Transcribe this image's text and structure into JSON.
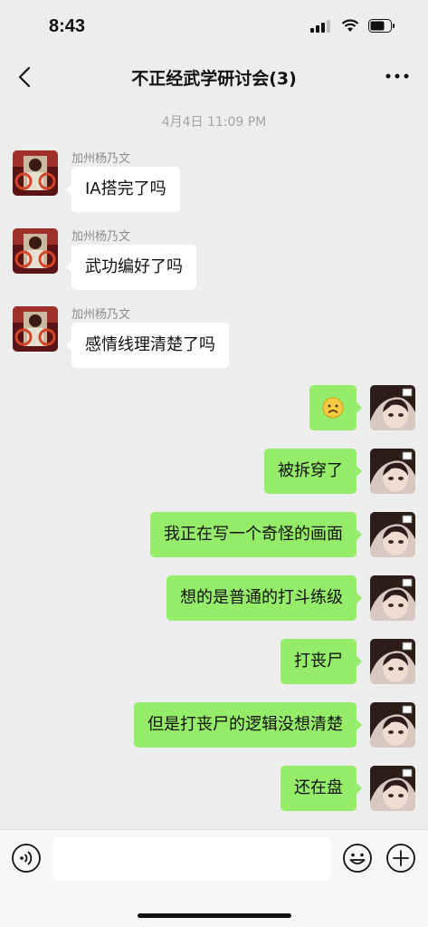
{
  "status": {
    "time": "8:43"
  },
  "nav": {
    "title": "不正经武学研讨会(3)"
  },
  "chat": {
    "timestamp": "4月4日 11:09 PM",
    "incoming": [
      {
        "sender": "加州杨乃文",
        "text": "IA搭完了吗"
      },
      {
        "sender": "加州杨乃文",
        "text": "武功编好了吗"
      },
      {
        "sender": "加州杨乃文",
        "text": "感情线理清楚了吗"
      }
    ],
    "outgoing": [
      {
        "text": "",
        "emoji": "frowning-face"
      },
      {
        "text": "被拆穿了"
      },
      {
        "text": "我正在写一个奇怪的画面"
      },
      {
        "text": "想的是普通的打斗练级"
      },
      {
        "text": "打丧尸"
      },
      {
        "text": "但是打丧尸的逻辑没想清楚"
      },
      {
        "text": "还在盘"
      }
    ]
  },
  "input": {
    "value": "",
    "placeholder": ""
  },
  "colors": {
    "bubble_out": "#95ec69",
    "bubble_in": "#ffffff",
    "background": "#ededed"
  }
}
